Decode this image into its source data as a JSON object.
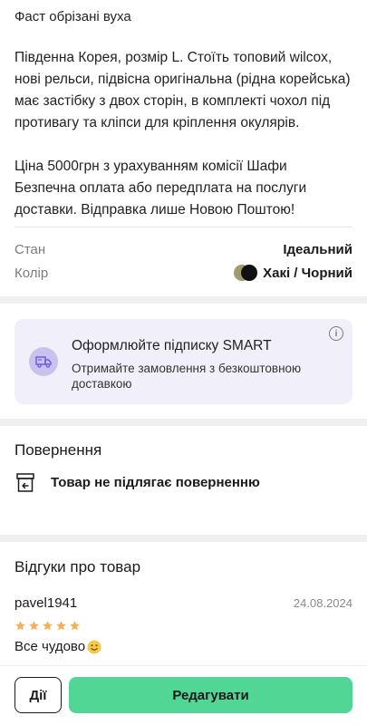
{
  "description": {
    "title": "Фаст обрізані вуха",
    "paragraph1": [
      "Південна Корея, розмір L. Стоїть топовий wilcox,",
      "нові рельси, підвісна оригінальна (рідна корейська)",
      "має застібку з двох сторін, в комплекті чохол під",
      "противагу та кліпси для кріплення окулярів."
    ],
    "paragraph2": [
      "Ціна 5000грн з урахуванням комісії Шафи",
      "Безпечна оплата або передплата на послуги",
      "доставки. Відправка лише Новою Поштою!"
    ]
  },
  "attributes": {
    "condition_label": "Стан",
    "condition_value": "Ідеальний",
    "color_label": "Колір",
    "color_value": "Хакі / Чорний",
    "swatch_colors": [
      "#a09a70",
      "#111111"
    ]
  },
  "smart": {
    "title": "Оформлюйте підписку SMART",
    "subtitle": "Отримайте замовлення з безкоштовною доставкою",
    "icon": "truck-icon",
    "info_icon": "info-icon"
  },
  "returns": {
    "title": "Повернення",
    "text": "Товар не підлягає поверненню",
    "icon": "return-box-icon"
  },
  "reviews": {
    "title": "Відгуки про товар",
    "items": [
      {
        "user": "pavel1941",
        "date": "24.08.2024",
        "rating": 5,
        "text": "Все чудово"
      }
    ]
  },
  "bottom_bar": {
    "actions_label": "Дії",
    "edit_label": "Редагувати",
    "accent": "#52d696"
  }
}
